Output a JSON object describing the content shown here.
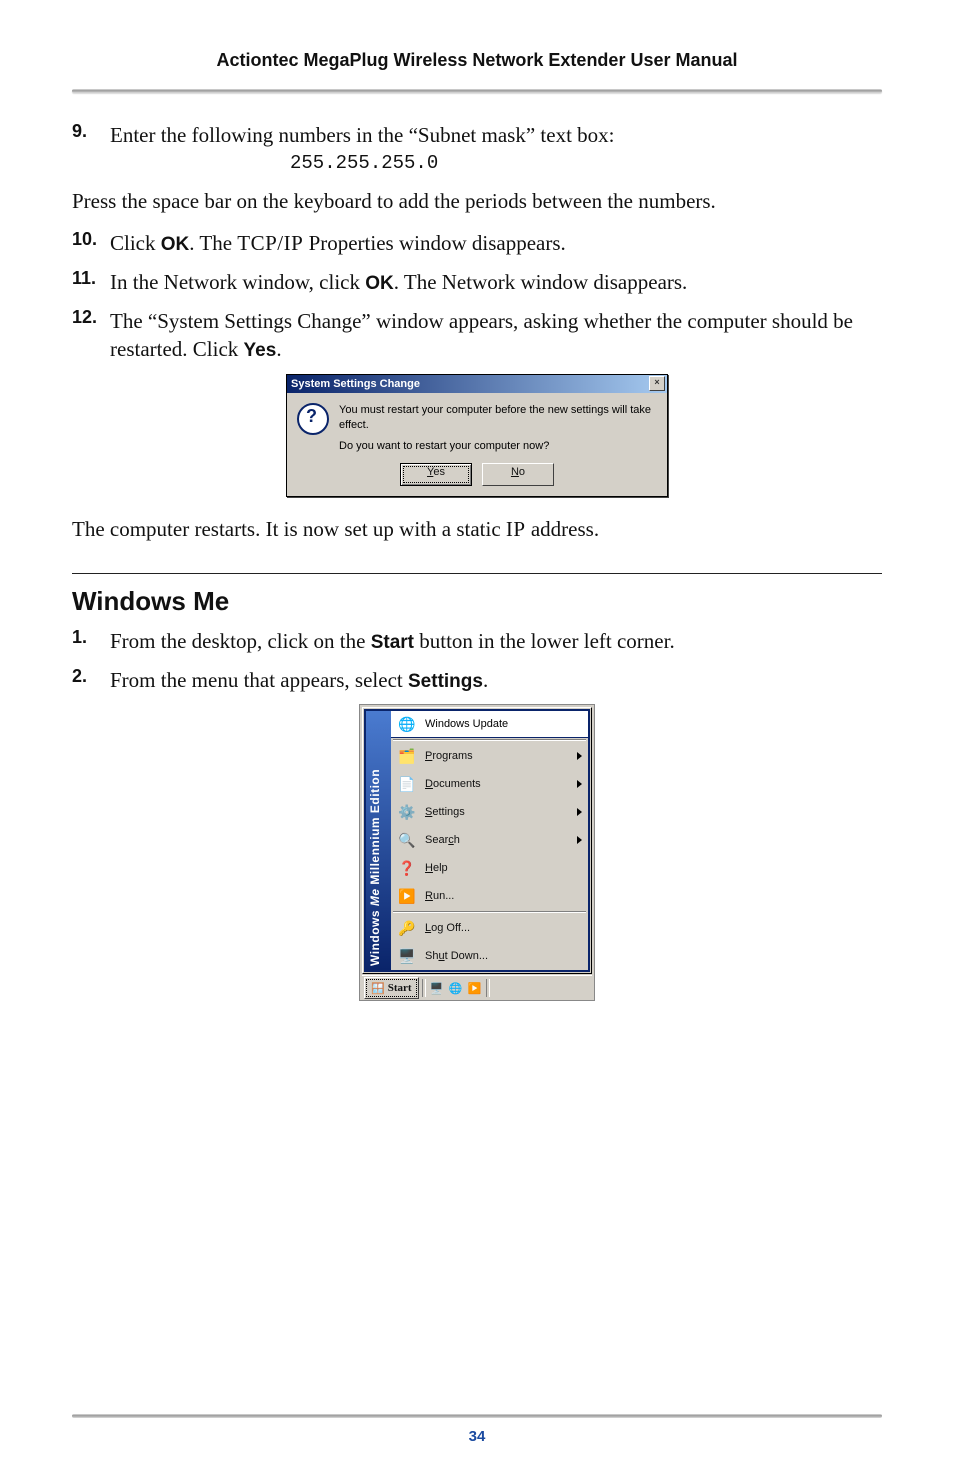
{
  "header": {
    "title": "Actiontec MegaPlug Wireless Network Extender User Manual"
  },
  "steps": {
    "s9": {
      "num": "9.",
      "text": "Enter the following numbers in the “Subnet mask” text box:",
      "code": "255.255.255.0"
    },
    "after9": "Press the space bar on the keyboard to add the periods between the numbers.",
    "s10": {
      "num": "10.",
      "pre": "Click ",
      "b1": "OK",
      "mid": ". The ",
      "sc": "TCP/IP",
      "post": " Properties window disappears."
    },
    "s11": {
      "num": "11.",
      "pre": "In the Network window, click ",
      "b1": "OK",
      "post": ". The Network window disappears."
    },
    "s12": {
      "num": "12.",
      "pre": "The “System Settings Change” window appears, asking whether the computer should be restarted. Click ",
      "b1": "Yes",
      "post": "."
    },
    "afterDialog_pre": "The computer restarts. It is now set up with a static ",
    "afterDialog_sc": "IP",
    "afterDialog_post": " address."
  },
  "dialog": {
    "title": "System Settings Change",
    "line1": "You must restart your computer before the new settings will take effect.",
    "line2": "Do you want to restart your computer now?",
    "yes_pre": "Y",
    "yes_rest": "es",
    "no_pre": "N",
    "no_rest": "o",
    "close": "×"
  },
  "section2": {
    "title": "Windows Me",
    "s1": {
      "num": "1.",
      "pre": "From the desktop, click on the ",
      "b1": "Start",
      "post": " button in the lower left corner."
    },
    "s2": {
      "num": "2.",
      "pre": "From the menu that appears, select ",
      "b1": "Settings",
      "post": "."
    }
  },
  "startmenu": {
    "side_a": "Windows",
    "side_b": "Me",
    "side_c": " Millennium Edition",
    "update": "Windows Update",
    "programs_u": "P",
    "programs_r": "rograms",
    "documents_u": "D",
    "documents_r": "ocuments",
    "settings_u": "S",
    "settings_r": "ettings",
    "search_u": "",
    "search_pre": "Sear",
    "search_c": "c",
    "search_r": "h",
    "help_u": "H",
    "help_r": "elp",
    "run_u": "R",
    "run_r": "un...",
    "logoff_u": "L",
    "logoff_r": "og Off...",
    "shutdown_pre": "Sh",
    "shutdown_u": "u",
    "shutdown_r": "t Down...",
    "start": "Start"
  },
  "footer": {
    "page": "34"
  },
  "chart_data": null
}
